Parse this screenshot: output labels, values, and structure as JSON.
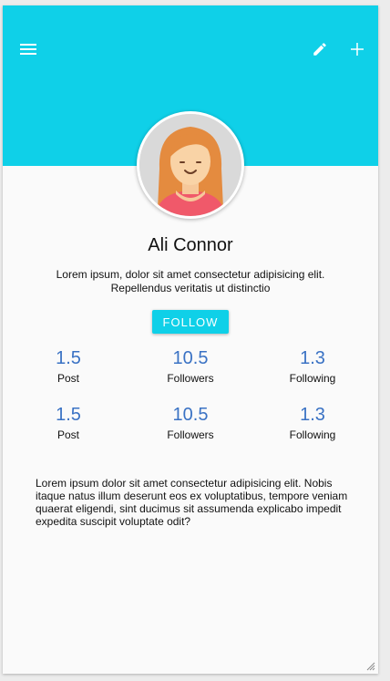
{
  "header": {
    "background_color": "#0fd0e8",
    "icons": {
      "menu": "menu-icon",
      "edit": "pencil-icon",
      "add": "plus-icon"
    }
  },
  "profile": {
    "name": "Ali Connor",
    "bio": "Lorem ipsum, dolor sit amet consectetur adipisicing elit. Repellendus veritatis ut distinctio",
    "follow_label": "FOLLOW"
  },
  "stats_rows": [
    [
      {
        "value": "1.5",
        "label": "Post"
      },
      {
        "value": "10.5",
        "label": "Followers"
      },
      {
        "value": "1.3",
        "label": "Following"
      }
    ],
    [
      {
        "value": "1.5",
        "label": "Post"
      },
      {
        "value": "10.5",
        "label": "Followers"
      },
      {
        "value": "1.3",
        "label": "Following"
      }
    ]
  ],
  "description": "Lorem ipsum dolor sit amet consectetur adipisicing elit. Nobis itaque natus illum deserunt eos ex voluptatibus, tempore veniam quaerat eligendi, sint ducimus sit assumenda explicabo impedit expedita suscipit voluptate odit?",
  "colors": {
    "accent": "#0fd0e8",
    "stat_value": "#3a72c4"
  }
}
